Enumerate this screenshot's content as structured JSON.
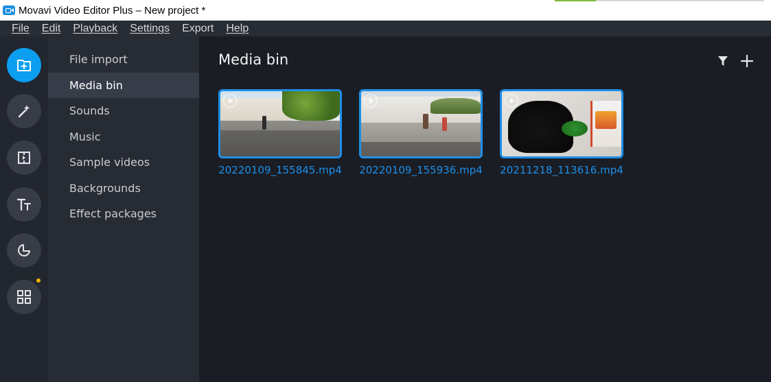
{
  "window": {
    "title": "Movavi Video Editor Plus – New project *"
  },
  "menubar": {
    "items": [
      "File",
      "Edit",
      "Playback",
      "Settings",
      "Export",
      "Help"
    ]
  },
  "rail": {
    "items": [
      {
        "name": "import",
        "icon": "import-plus-icon",
        "active": true
      },
      {
        "name": "filters",
        "icon": "magic-wand-icon",
        "active": false
      },
      {
        "name": "transitions",
        "icon": "transition-icon",
        "active": false
      },
      {
        "name": "titles",
        "icon": "titles-tt-icon",
        "active": false
      },
      {
        "name": "stickers",
        "icon": "sticker-icon",
        "active": false
      },
      {
        "name": "more-tools",
        "icon": "grid-icon",
        "active": false,
        "notification": true
      }
    ]
  },
  "categories": {
    "items": [
      "File import",
      "Media bin",
      "Sounds",
      "Music",
      "Sample videos",
      "Backgrounds",
      "Effect packages"
    ],
    "selected": "Media bin"
  },
  "main": {
    "title": "Media bin",
    "files": [
      {
        "name": "20220109_155845.mp4"
      },
      {
        "name": "20220109_155936.mp4"
      },
      {
        "name": "20211218_113616.mp4"
      }
    ]
  },
  "colors": {
    "accent": "#0c9ef0",
    "file_label": "#1e8fe8",
    "background": "#1a1d24",
    "notification_dot": "#f5b400"
  }
}
